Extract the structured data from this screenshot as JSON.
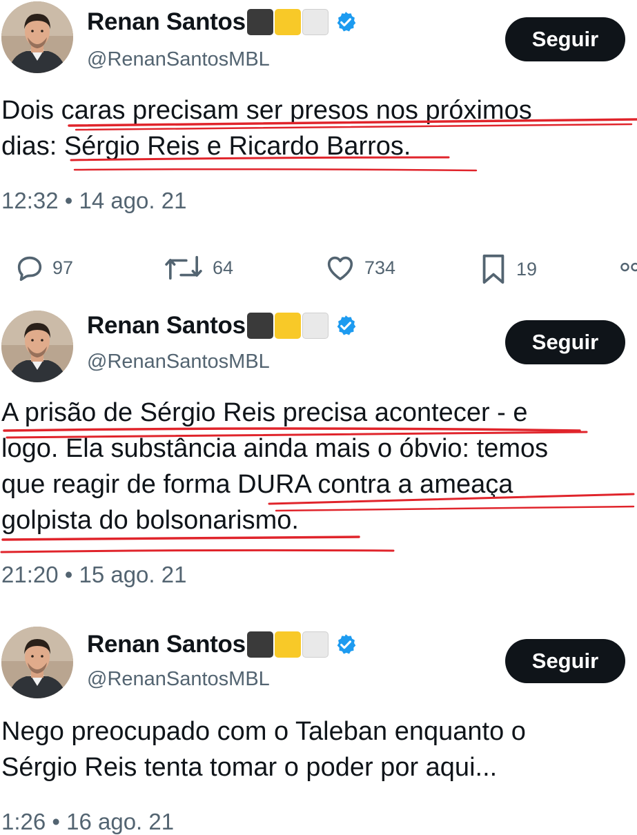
{
  "tweets": [
    {
      "author": "Renan Santos",
      "handle": "@RenanSantosMBL",
      "follow_label": "Seguir",
      "lines": [
        "Dois caras precisam ser presos nos próximos",
        "dias: Sérgio Reis e Ricardo Barros."
      ],
      "timestamp": "12:32 • 14 ago. 21",
      "stats": {
        "replies": "97",
        "retweets": "64",
        "likes": "734",
        "bookmarks": "19"
      }
    },
    {
      "author": "Renan Santos",
      "handle": "@RenanSantosMBL",
      "follow_label": "Seguir",
      "lines": [
        "A prisão de Sérgio Reis precisa acontecer - e",
        "logo. Ela substância ainda mais o óbvio: temos",
        "que reagir de forma DURA contra a ameaça",
        "golpista do bolsonarismo."
      ],
      "timestamp": "21:20 • 15 ago. 21"
    },
    {
      "author": "Renan Santos",
      "handle": "@RenanSantosMBL",
      "follow_label": "Seguir",
      "lines": [
        "Nego preocupado com o Taleban enquanto o",
        "Sérgio Reis tenta tomar o poder por aqui..."
      ],
      "timestamp": "1:26 • 16 ago. 21"
    }
  ],
  "flag_squares": [
    "black",
    "yellow",
    "white"
  ],
  "colors": {
    "accent": "#1d9bf0",
    "underline": "#e0242b",
    "button": "#0f1419",
    "muted": "#536471"
  },
  "icons": [
    "reply-icon",
    "retweet-icon",
    "like-icon",
    "bookmark-icon",
    "verified-badge-icon"
  ]
}
